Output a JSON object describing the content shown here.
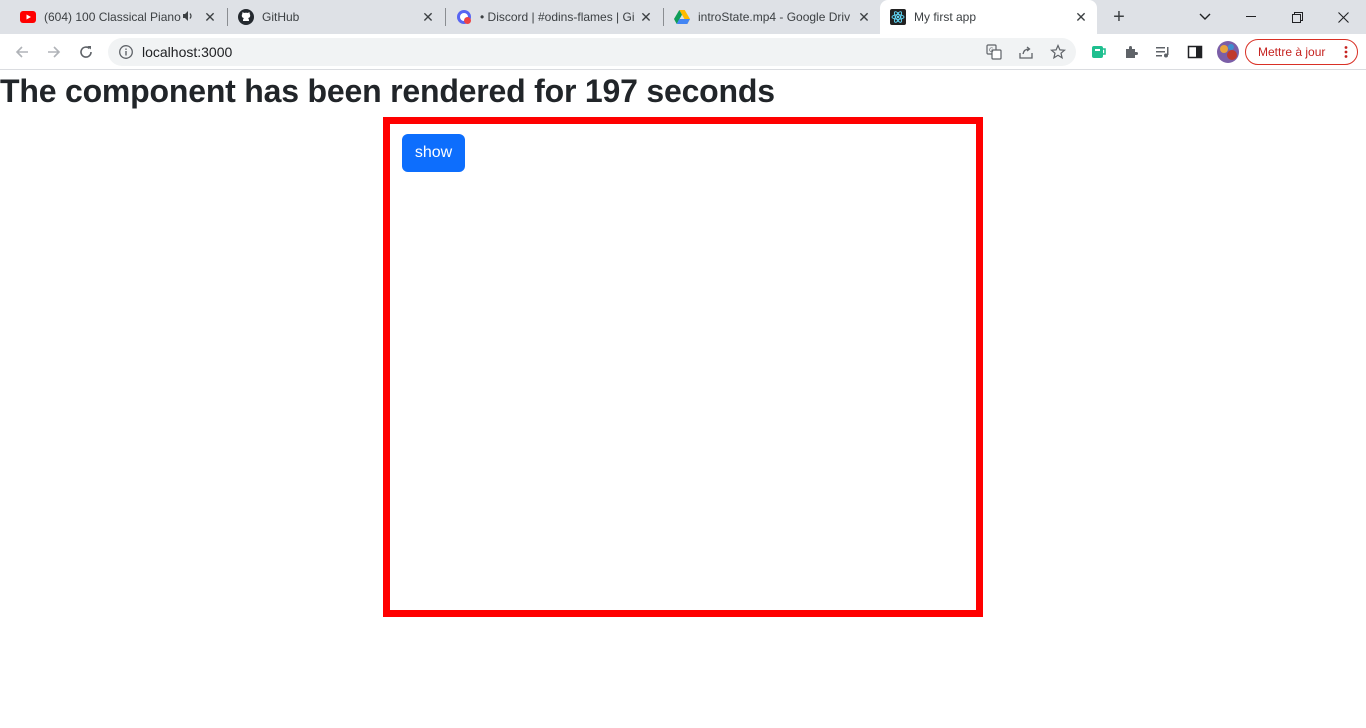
{
  "browser": {
    "tabs": [
      {
        "title": "(604) 100 Classical Piano",
        "favicon": "youtube-icon",
        "audio": true
      },
      {
        "title": "GitHub",
        "favicon": "github-icon"
      },
      {
        "title": "• Discord | #odins-flames | Gi",
        "favicon": "discord-icon"
      },
      {
        "title": "introState.mp4 - Google Driv",
        "favicon": "google-drive-icon"
      },
      {
        "title": "My first app",
        "favicon": "react-icon",
        "active": true
      }
    ],
    "url": "localhost:3000",
    "update_label": "Mettre à jour"
  },
  "page": {
    "heading": "The component has been rendered for 197 seconds",
    "show_button": "show"
  },
  "colors": {
    "box_border": "#ff0000",
    "button_bg": "#0d6efd",
    "heading_text": "#212529"
  }
}
